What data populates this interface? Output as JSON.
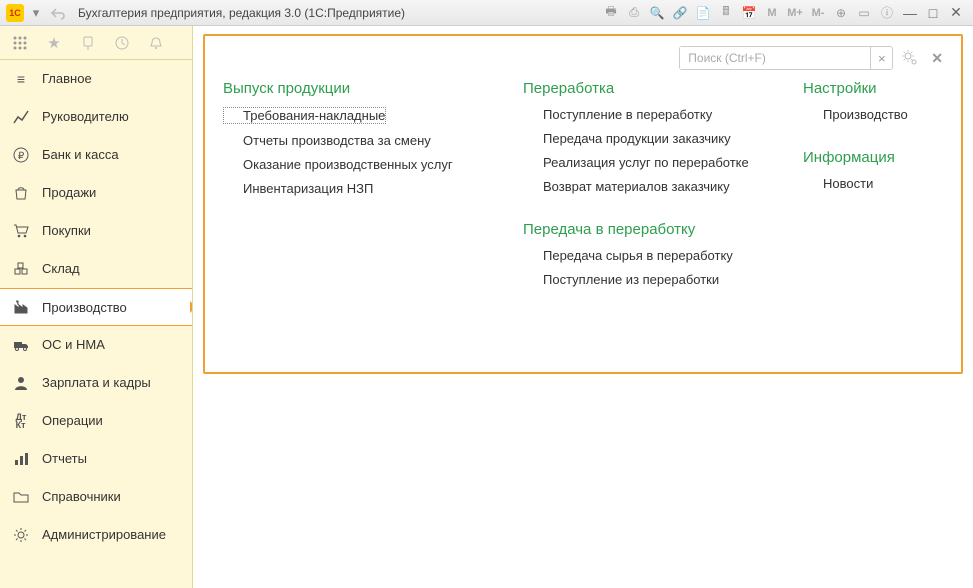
{
  "titlebar": {
    "logo": "1C",
    "title": "Бухгалтерия предприятия, редакция 3.0  (1С:Предприятие)",
    "mem": {
      "m": "M",
      "mplus": "M+",
      "mminus": "M-"
    }
  },
  "sidebar": {
    "items": [
      {
        "icon": "menu",
        "label": "Главное"
      },
      {
        "icon": "chart-up",
        "label": "Руководителю"
      },
      {
        "icon": "ruble",
        "label": "Банк и касса"
      },
      {
        "icon": "bag",
        "label": "Продажи"
      },
      {
        "icon": "cart",
        "label": "Покупки"
      },
      {
        "icon": "boxes",
        "label": "Склад"
      },
      {
        "icon": "factory",
        "label": "Производство"
      },
      {
        "icon": "truck",
        "label": "ОС и НМА"
      },
      {
        "icon": "person",
        "label": "Зарплата и кадры"
      },
      {
        "icon": "dtk",
        "label": "Операции"
      },
      {
        "icon": "bars",
        "label": "Отчеты"
      },
      {
        "icon": "folder",
        "label": "Справочники"
      },
      {
        "icon": "gear",
        "label": "Администрирование"
      }
    ]
  },
  "search": {
    "placeholder": "Поиск (Ctrl+F)"
  },
  "content": {
    "col1": {
      "title": "Выпуск продукции",
      "items": [
        "Требования-накладные",
        "Отчеты производства за смену",
        "Оказание производственных услуг",
        "Инвентаризация НЗП"
      ]
    },
    "col2a": {
      "title": "Переработка",
      "items": [
        "Поступление в переработку",
        "Передача продукции заказчику",
        "Реализация услуг по переработке",
        "Возврат материалов заказчику"
      ]
    },
    "col2b": {
      "title": "Передача в переработку",
      "items": [
        "Передача сырья в переработку",
        "Поступление из переработки"
      ]
    },
    "col3a": {
      "title": "Настройки",
      "items": [
        "Производство"
      ]
    },
    "col3b": {
      "title": "Информация",
      "items": [
        "Новости"
      ]
    }
  }
}
